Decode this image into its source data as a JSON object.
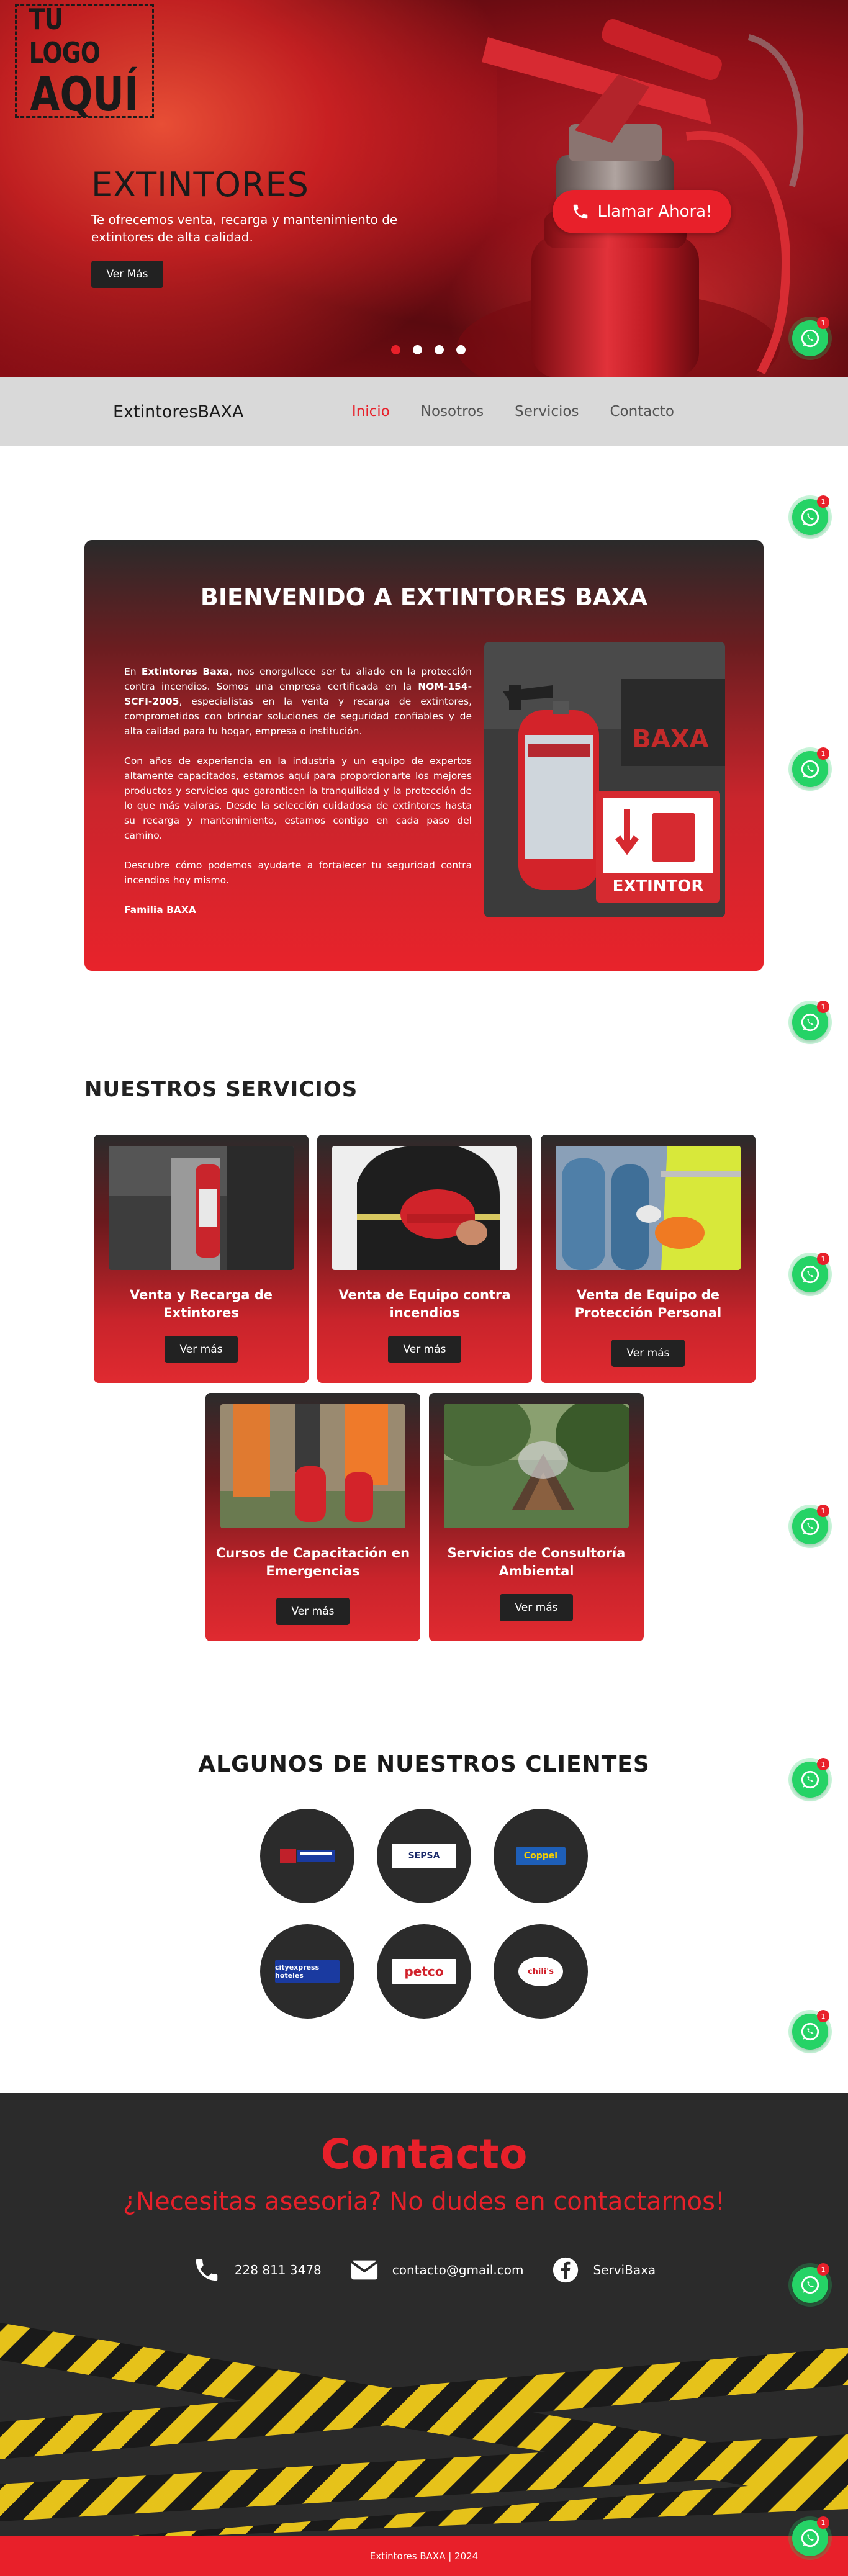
{
  "hero": {
    "logo_line1": "TU LOGO",
    "logo_line2": "AQUÍ",
    "title": "EXTINTORES",
    "subtitle": "Te ofrecemos venta, recarga y mantenimiento de extintores de alta calidad.",
    "button": "Ver Más",
    "call_button": "Llamar Ahora!",
    "slider_dots": 4,
    "active_dot": 1
  },
  "nav": {
    "brand": "ExtintoresBAXA",
    "links": [
      "Inicio",
      "Nosotros",
      "Servicios",
      "Contacto"
    ],
    "active": "Inicio"
  },
  "welcome": {
    "title": "BIENVENIDO A EXTINTORES BAXA",
    "p1_a": "En ",
    "p1_b": "Extintores Baxa",
    "p1_c": ", nos enorgullece ser tu aliado en la protección contra incendios. Somos una empresa certificada en la ",
    "p1_d": "NOM-154-SCFI-2005",
    "p1_e": ", especialistas en la venta y recarga de extintores, comprometidos con brindar soluciones de seguridad confiables y de alta calidad para tu hogar, empresa o institución.",
    "p2": "Con años de experiencia en la industria y un equipo de expertos altamente capacitados, estamos aquí para proporcionarte los mejores productos y servicios que garanticen la tranquilidad y la protección de lo que más valoras. Desde la selección cuidadosa de extintores hasta su recarga y mantenimiento, estamos contigo en cada paso del camino.",
    "p3": "Descubre cómo podemos ayudarte a fortalecer tu seguridad contra incendios hoy mismo.",
    "signature": "Familia BAXA",
    "photo_label": "EXTINTOR",
    "photo_brand": "BAXA"
  },
  "services": {
    "title": "NUESTROS SERVICIOS",
    "button": "Ver más",
    "items": [
      {
        "title": "Venta y Recarga de Extintores"
      },
      {
        "title": "Venta de Equipo contra incendios"
      },
      {
        "title": "Venta de Equipo de Protección Personal"
      },
      {
        "title": "Cursos de Capacitación en Emergencias"
      },
      {
        "title": "Servicios de Consultoría Ambiental"
      }
    ]
  },
  "clients": {
    "title": "ALGUNOS DE NUESTROS CLIENTES",
    "items": [
      "",
      "SEPSA",
      "Coppel",
      "cityexpress hoteles",
      "petco",
      "chili's"
    ]
  },
  "contact": {
    "title": "Contacto",
    "subtitle": "¿Necesitas asesoria? No dudes en contactarnos!",
    "phone": "228 811 3478",
    "email": "contacto@gmail.com",
    "facebook": "ServiBaxa"
  },
  "footer": {
    "text": "Extintores BAXA | 2024"
  },
  "whatsapp": {
    "badge": "1"
  },
  "colors": {
    "accent": "#e8202a",
    "dark": "#2b2b2b",
    "whatsapp": "#25d366"
  }
}
